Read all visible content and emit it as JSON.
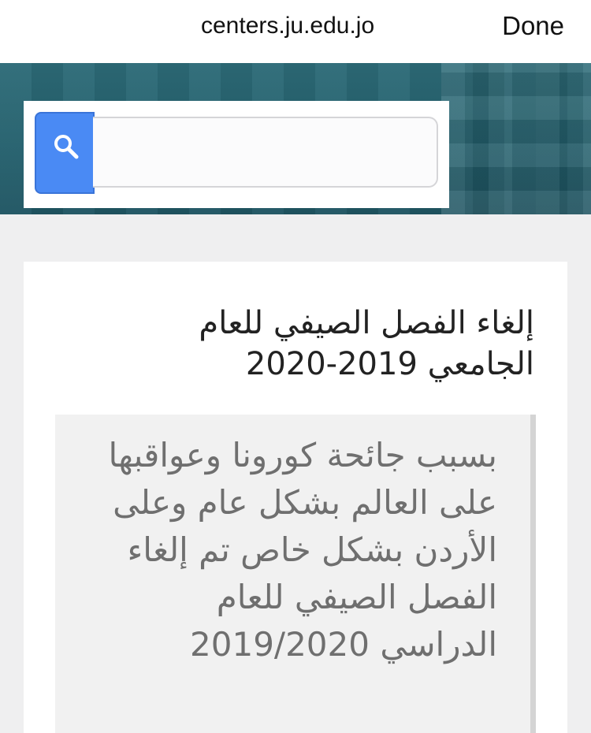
{
  "browser": {
    "url": "centers.ju.edu.jo",
    "done_label": "Done"
  },
  "search": {
    "placeholder": ""
  },
  "article": {
    "title": "إلغاء الفصل الصيفي للعام الجامعي 2019-2020",
    "quote": "بسبب جائحة كورونا وعواقبها على العالم بشكل عام وعلى الأردن بشكل خاص  تم إلغاء الفصل الصيفي للعام الدراسي 2019/2020"
  },
  "colors": {
    "banner": "#24606d",
    "search_button": "#4a8af4",
    "page_background": "#efeff0"
  },
  "icons": {
    "search": "magnifier-icon"
  }
}
